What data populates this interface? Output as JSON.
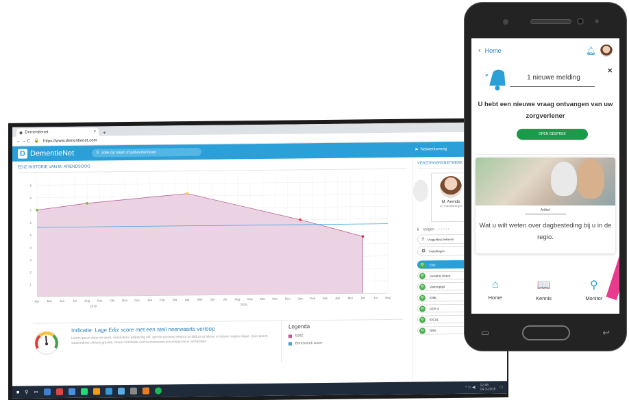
{
  "browser": {
    "tab_title": "Dementienet",
    "tab_close": "×",
    "new_tab": "+",
    "nav": "← → C",
    "url": "https://www.dementienet.com",
    "right_icons": "☆  ◆  ⚙"
  },
  "app": {
    "logo_letter": "D",
    "logo_text": "DementieNet",
    "search_placeholder": "zoek op naam of gebeurtenissen",
    "header_right": "Netwerkoverig"
  },
  "left": {
    "section_title": "EDIZ HISTORIE VAN M. ARENDSOOG",
    "info_title": "Indicatie: Lage Ediz score met een steil neerwaarts verloop",
    "info_body": "Lorem ipsum dolor sit amet, consectetur adipiscing elit, sed do eiusmod tempor incididunt ut labore et dolore magna aliqua. Quis ipsum suspendisse ultrices gravida. Risus commodo viverra maecenas accumsan lacus vel facilisis.",
    "legend_title": "Legenda",
    "legend": [
      {
        "label": "EDIZ",
        "color": "#c2559b"
      },
      {
        "label": "Benchmark score",
        "color": "#3da5e0"
      }
    ]
  },
  "chart_data": {
    "type": "area",
    "x": [
      "Apr",
      "Mei",
      "Jun",
      "Jul",
      "Aug",
      "Sep",
      "Okt",
      "Nov",
      "Dec",
      "Jan",
      "Feb",
      "Ma",
      "Apr",
      "Mei",
      "Jun",
      "Jul",
      "Aug",
      "Sep",
      "Okt",
      "Nov",
      "Dec",
      "Jan",
      "Feb",
      "Ma",
      "Apr",
      "Mei",
      "Jun",
      "Jul",
      "Aug"
    ],
    "year_labels": [
      "2018",
      "2019"
    ],
    "y_ticks": [
      "1",
      "2",
      "3",
      "4",
      "5",
      "6",
      "7",
      "8",
      "9"
    ],
    "series": [
      {
        "name": "EDIZ",
        "points": [
          {
            "x": 0,
            "y": 7.0
          },
          {
            "x": 4,
            "y": 7.5
          },
          {
            "x": 12,
            "y": 8.2
          },
          {
            "x": 21,
            "y": 6.0
          },
          {
            "x": 26,
            "y": 4.6
          }
        ]
      },
      {
        "name": "Benchmark score",
        "points": [
          {
            "x": 0,
            "y": 5.6
          },
          {
            "x": 28,
            "y": 5.6
          }
        ]
      }
    ],
    "ylim": [
      0,
      9.5
    ]
  },
  "right": {
    "section_title": "VERZORGERSNETWERK F.A.",
    "carer_name": "M. Arends",
    "carer_role": "1e mantelzorger",
    "follow": "Volgen",
    "menu": [
      {
        "icon": "?",
        "label": "Vragenlijst beheren"
      },
      {
        "icon": "⚙",
        "label": "Instellingen"
      }
    ],
    "pills": [
      "Ediz",
      "Geriatric Depre",
      "Velleruptijd",
      "IDML",
      "GDS 4",
      "IDCAL",
      "DRS"
    ]
  },
  "taskbar": {
    "time": "12:46",
    "date": "14-3-2019"
  },
  "phone": {
    "back_label": "Home",
    "notif_count": "1 nieuwe melding",
    "notif_message": "U hebt een nieuwe vraag ontvangen van uw zorgverlener",
    "notif_button": "OPEN GESPREK",
    "article_tag": "Artikel",
    "article_title": "Wat u wilt weten over dagbesteding bij u in de regio.",
    "nav": [
      {
        "icon": "⌂",
        "label": "Home"
      },
      {
        "icon": "📖",
        "label": "Kennis"
      },
      {
        "icon": "⚲",
        "label": "Monitor"
      }
    ]
  }
}
